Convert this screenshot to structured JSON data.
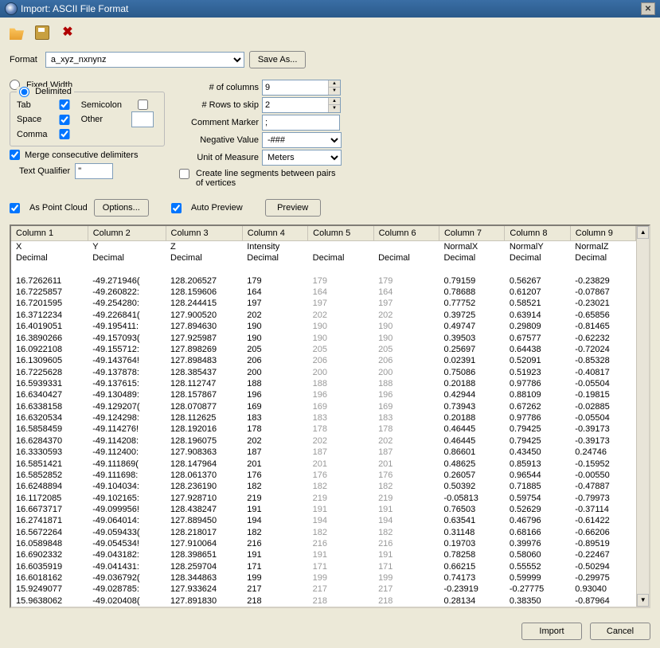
{
  "title": "Import: ASCII File Format",
  "format": {
    "label": "Format",
    "value": "a_xyz_nxnynz",
    "save_as": "Save As..."
  },
  "radios": {
    "fixed": "Fixed Width",
    "delim": "Delimited"
  },
  "delims": {
    "tab": "Tab",
    "space": "Space",
    "comma": "Comma",
    "semi": "Semicolon",
    "other": "Other",
    "merge": "Merge consecutive delimiters",
    "tq": "Text Qualifier",
    "tq_val": "\""
  },
  "right": {
    "ncols": "# of columns",
    "ncols_v": "9",
    "nskip": "# Rows to skip",
    "nskip_v": "2",
    "cmarker": "Comment Marker",
    "cmarker_v": ";",
    "neg": "Negative Value",
    "neg_v": "-###",
    "unit": "Unit of Measure",
    "unit_v": "Meters",
    "lineseg": "Create line segments between pairs of vertices"
  },
  "row2": {
    "aspc": "As Point Cloud",
    "options": "Options...",
    "autoprev": "Auto Preview",
    "preview": "Preview"
  },
  "cols": [
    "Column 1",
    "Column 2",
    "Column 3",
    "Column 4",
    "Column 5",
    "Column 6",
    "Column 7",
    "Column 8",
    "Column 9"
  ],
  "hdr1": [
    "X",
    "Y",
    "Z",
    "Intensity",
    "",
    "",
    "NormalX",
    "NormalY",
    "NormalZ"
  ],
  "hdr2": [
    "Decimal",
    "Decimal",
    "Decimal",
    "Decimal",
    "Decimal",
    "Decimal",
    "Decimal",
    "Decimal",
    "Decimal"
  ],
  "rows": [
    [
      "16.7262611",
      "-49.271946(",
      "128.206527",
      "179",
      "179",
      "179",
      "0.79159",
      "0.56267",
      "-0.23829"
    ],
    [
      "16.7225857",
      "-49.260822:",
      "128.159606",
      "164",
      "164",
      "164",
      "0.78688",
      "0.61207",
      "-0.07867"
    ],
    [
      "16.7201595",
      "-49.254280:",
      "128.244415",
      "197",
      "197",
      "197",
      "0.77752",
      "0.58521",
      "-0.23021"
    ],
    [
      "16.3712234",
      "-49.226841(",
      "127.900520",
      "202",
      "202",
      "202",
      "0.39725",
      "0.63914",
      "-0.65856"
    ],
    [
      "16.4019051",
      "-49.195411:",
      "127.894630",
      "190",
      "190",
      "190",
      "0.49747",
      "0.29809",
      "-0.81465"
    ],
    [
      "16.3890266",
      "-49.157093(",
      "127.925987",
      "190",
      "190",
      "190",
      "0.39503",
      "0.67577",
      "-0.62232"
    ],
    [
      "16.0922108",
      "-49.155712:",
      "127.898269",
      "205",
      "205",
      "205",
      "0.25697",
      "0.64438",
      "-0.72024"
    ],
    [
      "16.1309605",
      "-49.143764!",
      "127.898483",
      "206",
      "206",
      "206",
      "0.02391",
      "0.52091",
      "-0.85328"
    ],
    [
      "16.7225628",
      "-49.137878:",
      "128.385437",
      "200",
      "200",
      "200",
      "0.75086",
      "0.51923",
      "-0.40817"
    ],
    [
      "16.5939331",
      "-49.137615:",
      "128.112747",
      "188",
      "188",
      "188",
      "0.20188",
      "0.97786",
      "-0.05504"
    ],
    [
      "16.6340427",
      "-49.130489:",
      "128.157867",
      "196",
      "196",
      "196",
      "0.42944",
      "0.88109",
      "-0.19815"
    ],
    [
      "16.6338158",
      "-49.129207(",
      "128.070877",
      "169",
      "169",
      "169",
      "0.73943",
      "0.67262",
      "-0.02885"
    ],
    [
      "16.6320534",
      "-49.124298:",
      "128.112625",
      "183",
      "183",
      "183",
      "0.20188",
      "0.97786",
      "-0.05504"
    ],
    [
      "16.5858459",
      "-49.114276!",
      "128.192016",
      "178",
      "178",
      "178",
      "0.46445",
      "0.79425",
      "-0.39173"
    ],
    [
      "16.6284370",
      "-49.114208:",
      "128.196075",
      "202",
      "202",
      "202",
      "0.46445",
      "0.79425",
      "-0.39173"
    ],
    [
      "16.3330593",
      "-49.112400:",
      "127.908363",
      "187",
      "187",
      "187",
      "0.86601",
      "0.43450",
      "0.24746"
    ],
    [
      "16.5851421",
      "-49.111869(",
      "128.147964",
      "201",
      "201",
      "201",
      "0.48625",
      "0.85913",
      "-0.15952"
    ],
    [
      "16.5852852",
      "-49.111698:",
      "128.061370",
      "176",
      "176",
      "176",
      "0.26057",
      "0.96544",
      "-0.00550"
    ],
    [
      "16.6248894",
      "-49.104034:",
      "128.236190",
      "182",
      "182",
      "182",
      "0.50392",
      "0.71885",
      "-0.47887"
    ],
    [
      "16.1172085",
      "-49.102165:",
      "127.928710",
      "219",
      "219",
      "219",
      "-0.05813",
      "0.59754",
      "-0.79973"
    ],
    [
      "16.6673717",
      "-49.099956!",
      "128.438247",
      "191",
      "191",
      "191",
      "0.76503",
      "0.52629",
      "-0.37114"
    ],
    [
      "16.2741871",
      "-49.064014:",
      "127.889450",
      "194",
      "194",
      "194",
      "0.63541",
      "0.46796",
      "-0.61422"
    ],
    [
      "16.5672264",
      "-49.059433(",
      "128.218017",
      "182",
      "182",
      "182",
      "0.31148",
      "0.68166",
      "-0.66206"
    ],
    [
      "16.0589848",
      "-49.054534!",
      "127.910064",
      "216",
      "216",
      "216",
      "0.19703",
      "0.39976",
      "-0.89519"
    ],
    [
      "16.6902332",
      "-49.043182:",
      "128.398651",
      "191",
      "191",
      "191",
      "0.78258",
      "0.58060",
      "-0.22467"
    ],
    [
      "16.6035919",
      "-49.041431:",
      "128.259704",
      "171",
      "171",
      "171",
      "0.66215",
      "0.55552",
      "-0.50294"
    ],
    [
      "16.6018162",
      "-49.036792(",
      "128.344863",
      "199",
      "199",
      "199",
      "0.74173",
      "0.59999",
      "-0.29975"
    ],
    [
      "15.9249077",
      "-49.028785:",
      "127.933624",
      "217",
      "217",
      "217",
      "-0.23919",
      "-0.27775",
      "0.93040"
    ],
    [
      "15.9638062",
      "-49.020408(",
      "127.891830",
      "218",
      "218",
      "218",
      "0.28134",
      "0.38350",
      "-0.87964"
    ]
  ],
  "footer": {
    "import": "Import",
    "cancel": "Cancel"
  }
}
